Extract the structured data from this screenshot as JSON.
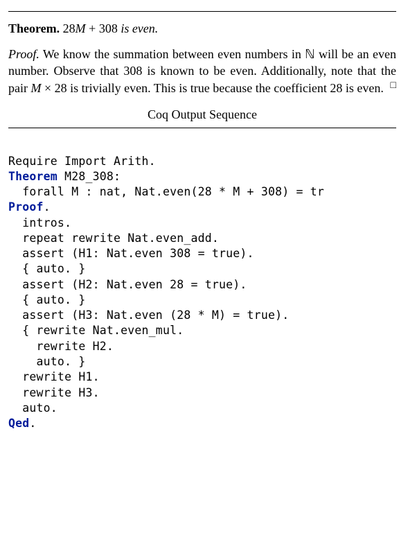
{
  "theorem": {
    "label": "Theorem.",
    "expr_a": "28",
    "expr_var": "M",
    "expr_plus": " + ",
    "expr_b": "308",
    "statement_tail": " is even."
  },
  "proof": {
    "label": "Proof.",
    "body_html": "We know the summation between even numbers in ℕ will be an even number. Observe that 308 is known to be even.  Additionally, note that the pair <span class=\"math\"><span class=\"var\">M</span> × 28</span> is trivially even. This is true because the coefficient 28 is even."
  },
  "coq_title": "Coq Output Sequence",
  "code": {
    "l01": "Require Import Arith.",
    "l02a": "Theorem",
    "l02b": " M28_308:",
    "l03": "  forall M : nat, Nat.even(28 * M + 308) = tr",
    "l04": "Proof",
    "l04b": ".",
    "l05": "  intros.",
    "l06": "  repeat rewrite Nat.even_add.",
    "l07": "  assert (H1: Nat.even 308 = true).",
    "l08": "  { auto. }",
    "l09": "  assert (H2: Nat.even 28 = true).",
    "l10": "  { auto. }",
    "l11": "  assert (H3: Nat.even (28 * M) = true).",
    "l12": "  { rewrite Nat.even_mul.",
    "l13": "    rewrite H2.",
    "l14": "    auto. }",
    "l15": "  rewrite H1.",
    "l16": "  rewrite H3.",
    "l17": "  auto.",
    "l18": "Qed",
    "l18b": "."
  }
}
